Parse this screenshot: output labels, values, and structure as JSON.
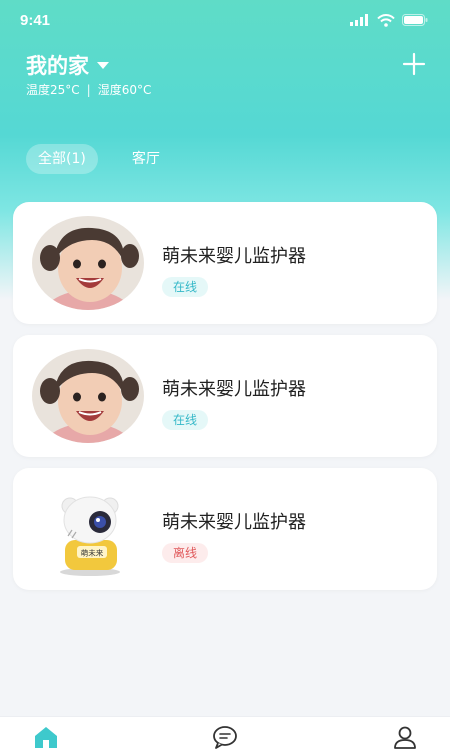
{
  "status_bar": {
    "time": "9:41",
    "icons": [
      "signal-icon",
      "wifi-icon",
      "battery-icon"
    ]
  },
  "header": {
    "title": "我的家",
    "temperature": "温度25°C",
    "humidity": "湿度60°C",
    "separator": "|"
  },
  "tabs": [
    {
      "label": "全部(1)",
      "active": true
    },
    {
      "label": "客厅",
      "active": false
    }
  ],
  "devices": [
    {
      "name": "萌未来婴儿监护器",
      "status": "在线",
      "status_type": "online",
      "image": "baby-photo"
    },
    {
      "name": "萌未来婴儿监护器",
      "status": "在线",
      "status_type": "online",
      "image": "baby-photo"
    },
    {
      "name": "萌未来婴儿监护器",
      "status": "离线",
      "status_type": "offline",
      "image": "camera-robot",
      "camera_logo_text": "萌未来"
    }
  ],
  "bottom_nav": [
    {
      "name": "home",
      "icon": "home-icon",
      "active": true
    },
    {
      "name": "messages",
      "icon": "message-icon",
      "active": false
    },
    {
      "name": "profile",
      "icon": "user-icon",
      "active": false
    }
  ],
  "colors": {
    "accent": "#4fd3d2",
    "online_text": "#35b8c8",
    "offline_text": "#e0595b",
    "nav_active": "#3ec9cc",
    "nav_inactive": "#333333"
  }
}
